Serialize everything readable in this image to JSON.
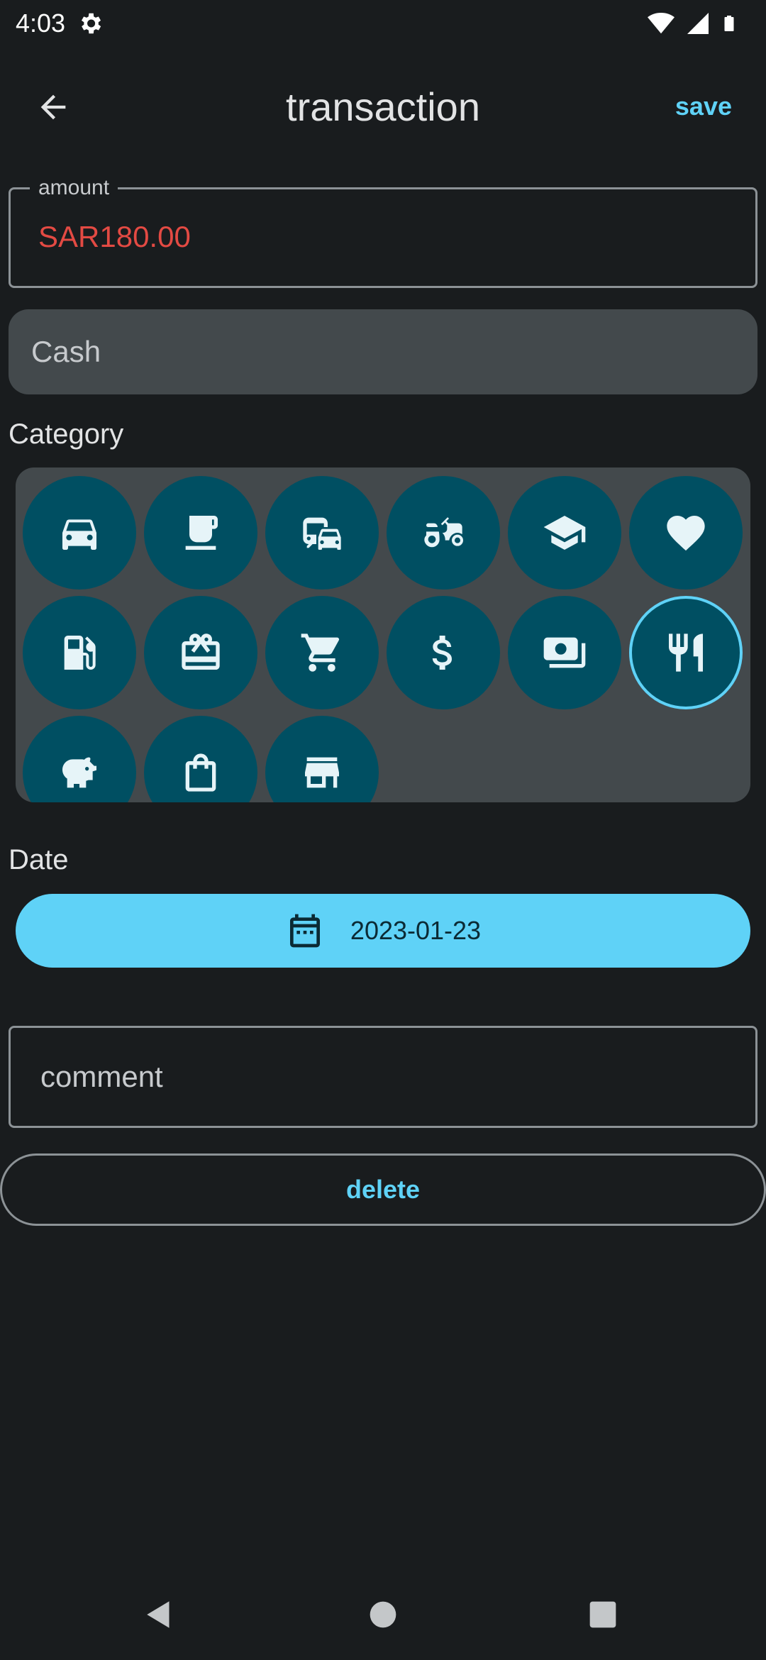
{
  "status_bar": {
    "time": "4:03",
    "icons": [
      "settings-icon",
      "wifi-icon",
      "signal-icon",
      "battery-icon"
    ]
  },
  "header": {
    "title": "transaction",
    "save_label": "save",
    "back_icon": "arrow-left-icon"
  },
  "amount": {
    "label": "amount",
    "value": "SAR180.00",
    "value_color": "#e34a43"
  },
  "account": {
    "value": "Cash"
  },
  "category": {
    "label": "Category",
    "items": [
      {
        "icon": "car-icon"
      },
      {
        "icon": "coffee-cup-icon"
      },
      {
        "icon": "commute-icon"
      },
      {
        "icon": "tractor-icon"
      },
      {
        "icon": "graduation-cap-icon"
      },
      {
        "icon": "heart-icon"
      },
      {
        "icon": "fuel-pump-icon"
      },
      {
        "icon": "gift-card-icon"
      },
      {
        "icon": "shopping-cart-icon"
      },
      {
        "icon": "dollar-icon"
      },
      {
        "icon": "money-bill-icon"
      },
      {
        "icon": "restaurant-icon",
        "selected": true
      },
      {
        "icon": "piggy-bank-icon"
      },
      {
        "icon": "shopping-bag-icon"
      },
      {
        "icon": "store-icon"
      }
    ]
  },
  "date": {
    "label": "Date",
    "value": "2023-01-23"
  },
  "comment": {
    "placeholder": "comment"
  },
  "delete_label": "delete",
  "colors": {
    "accent": "#5fd2f7",
    "background": "#191c1e",
    "chip": "#004f62",
    "panel": "#43494c"
  }
}
